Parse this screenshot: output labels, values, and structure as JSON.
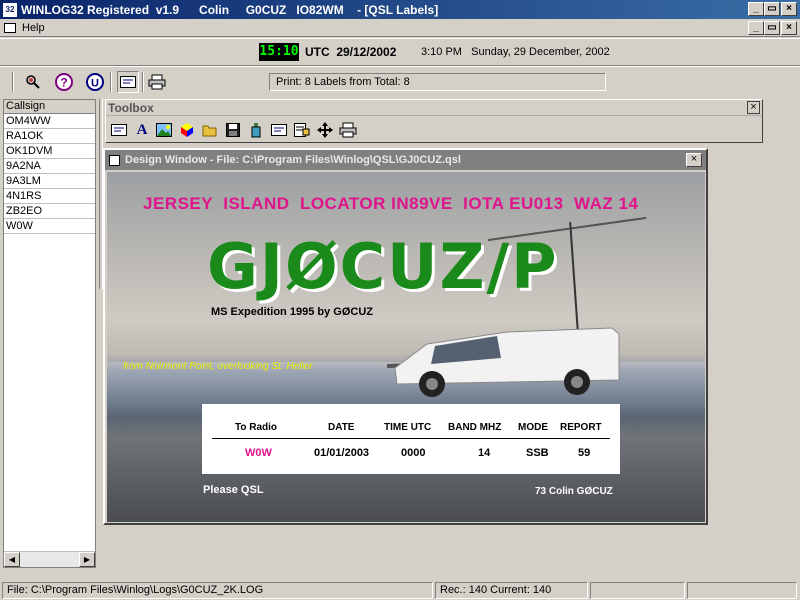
{
  "window": {
    "title": "WINLOG32 Registered  v1.9      Colin     G0CUZ   IO82WM    - [QSL Labels]",
    "icon_label": "32"
  },
  "menu": {
    "help": "Help"
  },
  "time": {
    "clock": "15:10",
    "utc_label": "UTC  29/12/2002",
    "local": "3:10 PM   Sunday, 29 December, 2002"
  },
  "toolbar": {
    "print_info": "Print: 8 Labels from Total: 8"
  },
  "callsign_list": {
    "header": "Callsign",
    "items": [
      "OM4WW",
      "RA1OK",
      "OK1DVM",
      "9A2NA",
      "9A3LM",
      "4N1RS",
      "ZB2EO",
      "W0W"
    ]
  },
  "toolbox": {
    "title": "Toolbox"
  },
  "design_window": {
    "title": "Design Window - File: C:\\Program Files\\Winlog\\QSL\\GJ0CUZ.qsl",
    "headline": "JERSEY  ISLAND  LOCATOR IN89VE  IOTA EU013  WAZ 14",
    "callsign": "GJØCUZ/P",
    "expedition": "MS Expedition 1995 by GØCUZ",
    "location": "from Noirmont Point, overlooking St. Helier",
    "table": {
      "headers": [
        "To Radio",
        "DATE",
        "TIME UTC",
        "BAND MHZ",
        "MODE",
        "REPORT"
      ],
      "row": [
        "W0W",
        "01/01/2003",
        "0000",
        "14",
        "SSB",
        "59"
      ]
    },
    "please_qsl": "Please QSL",
    "signoff": "73 Colin GØCUZ"
  },
  "status": {
    "file": "File: C:\\Program Files\\Winlog\\Logs\\G0CUZ_2K.LOG",
    "records": "Rec.: 140  Current: 140"
  },
  "colors": {
    "headline": "#e0148c",
    "callsign": "#1a8a1a",
    "location": "#e8f000",
    "table_call": "#e0148c",
    "clock_fg": "#00ff00"
  }
}
